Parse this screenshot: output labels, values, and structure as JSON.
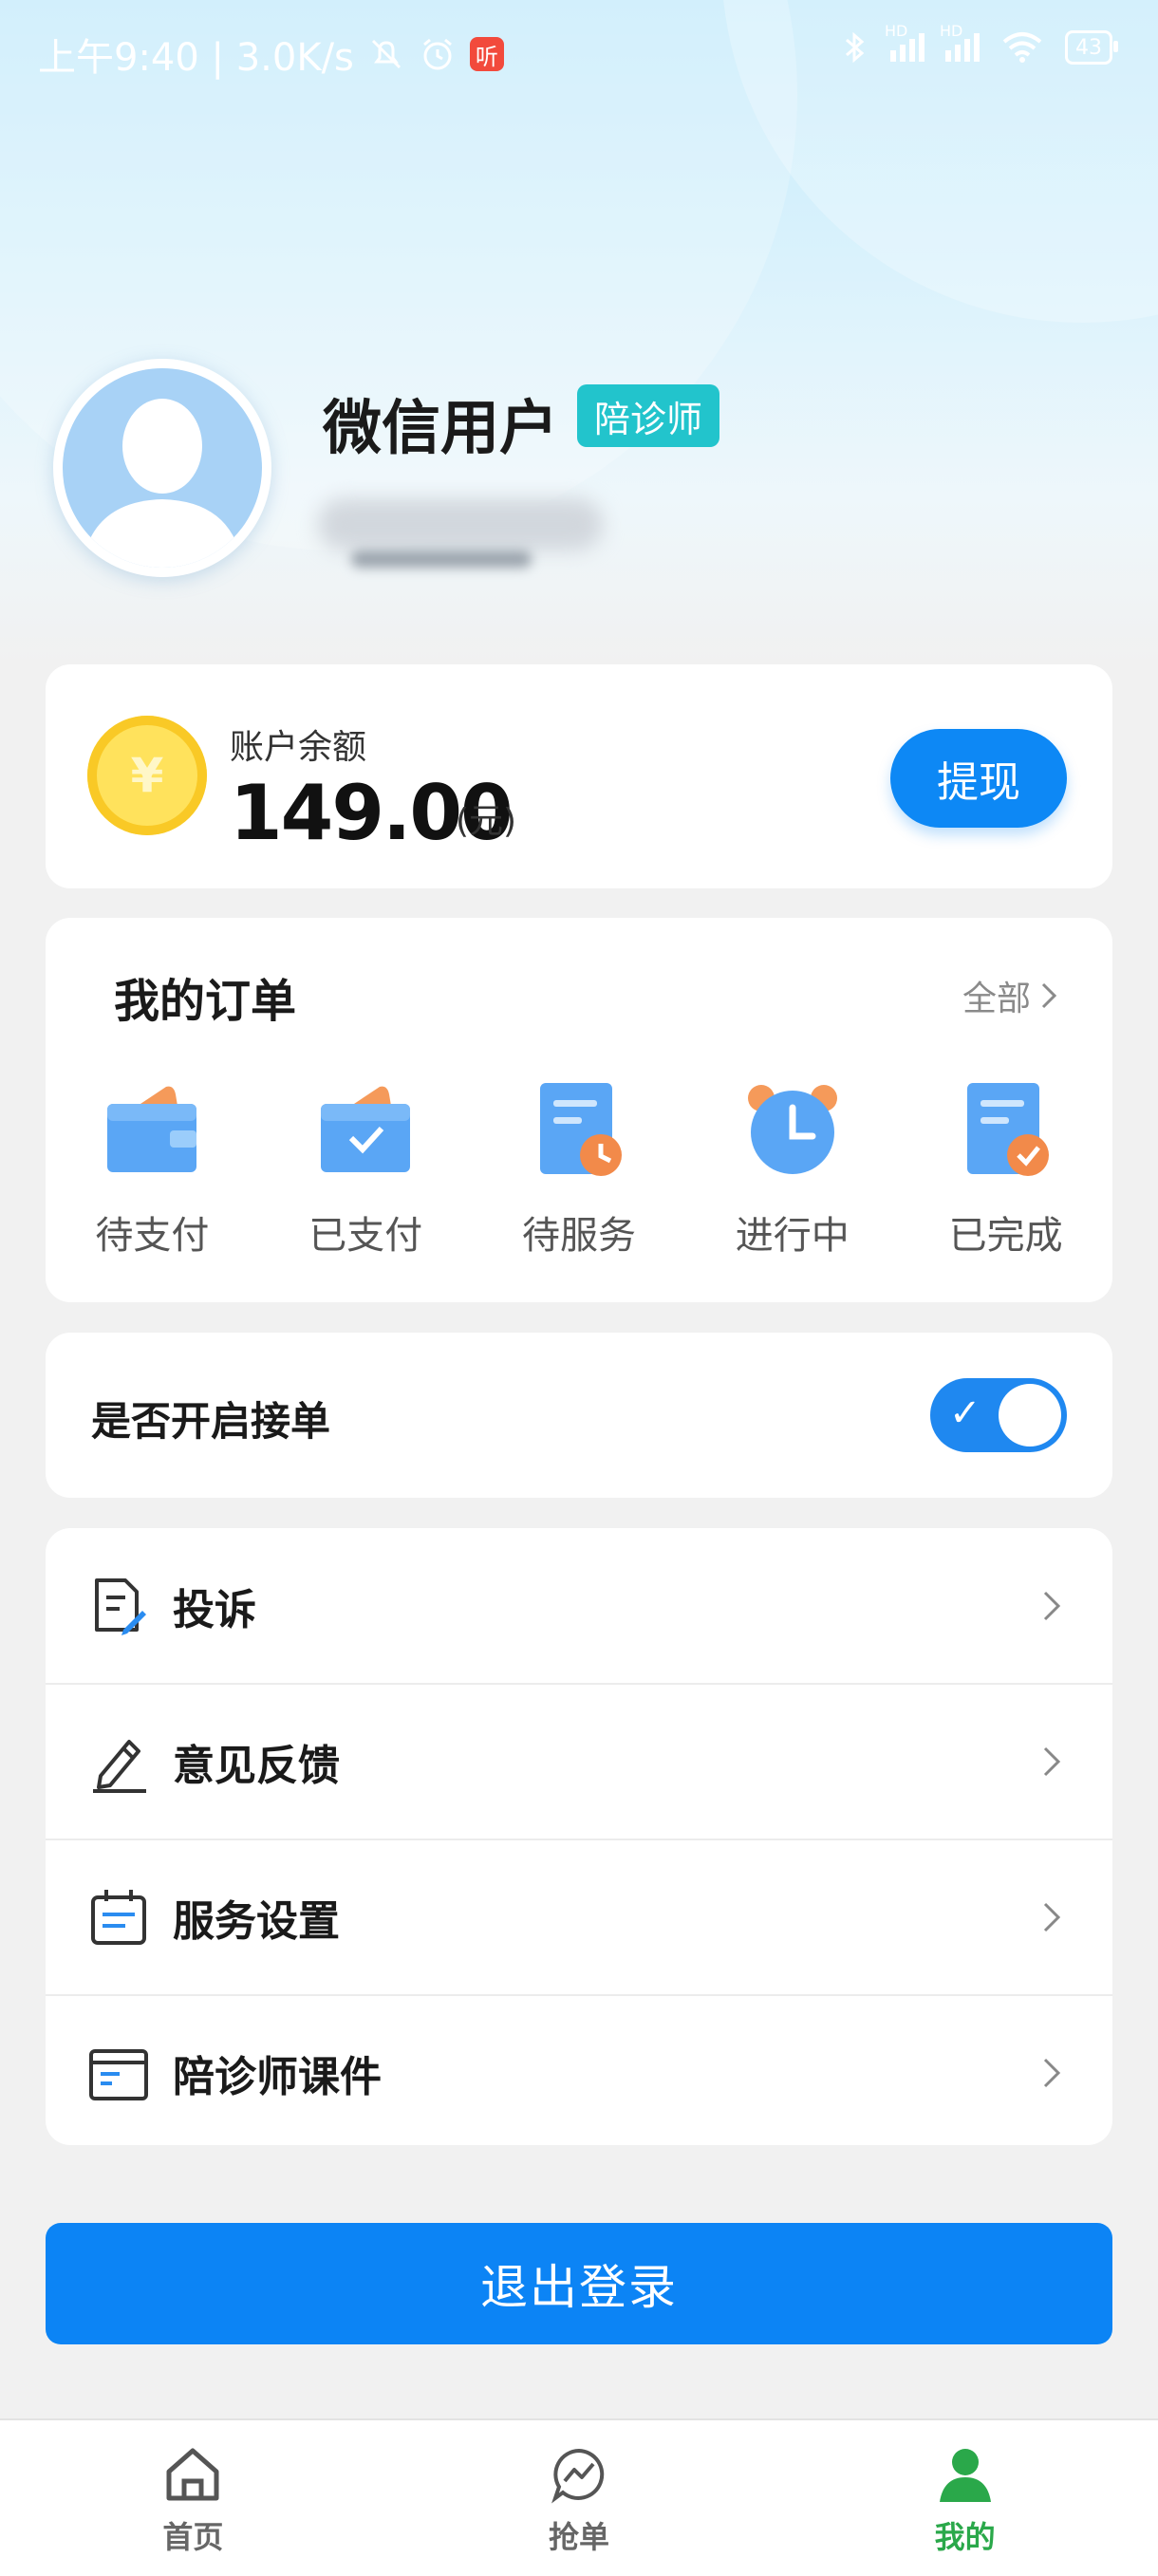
{
  "status_bar": {
    "time": "上午9:40 | 3.0K/s",
    "app_badge": "听",
    "signal1": "HD",
    "signal2": "HD",
    "battery": "43"
  },
  "profile": {
    "nickname": "微信用户",
    "role_tag": "陪诊师"
  },
  "balance": {
    "label": "账户余额",
    "amount": "149.00",
    "unit": "(元)",
    "currency_symbol": "¥",
    "withdraw_label": "提现"
  },
  "orders": {
    "title": "我的订单",
    "all_label": "全部",
    "items": [
      {
        "label": "待支付",
        "icon": "wallet-icon"
      },
      {
        "label": "已支付",
        "icon": "wallet-check-icon"
      },
      {
        "label": "待服务",
        "icon": "document-clock-icon"
      },
      {
        "label": "进行中",
        "icon": "alarm-clock-icon"
      },
      {
        "label": "已完成",
        "icon": "document-check-icon"
      }
    ]
  },
  "accept_orders": {
    "label": "是否开启接单",
    "enabled": true
  },
  "menu": {
    "items": [
      {
        "label": "投诉",
        "icon": "complaint-document-icon"
      },
      {
        "label": "意见反馈",
        "icon": "pencil-icon"
      },
      {
        "label": "服务设置",
        "icon": "calendar-icon"
      },
      {
        "label": "陪诊师课件",
        "icon": "folder-icon"
      }
    ]
  },
  "logout_label": "退出登录",
  "tabbar": {
    "items": [
      {
        "label": "首页",
        "icon": "home-icon"
      },
      {
        "label": "抢单",
        "icon": "grab-order-icon"
      },
      {
        "label": "我的",
        "icon": "user-icon"
      }
    ],
    "active_index": 2
  },
  "colors": {
    "primary": "#0c84f5",
    "tag": "#22c4cc",
    "active_tab": "#2aa84a",
    "coin": "#ffe25c"
  }
}
